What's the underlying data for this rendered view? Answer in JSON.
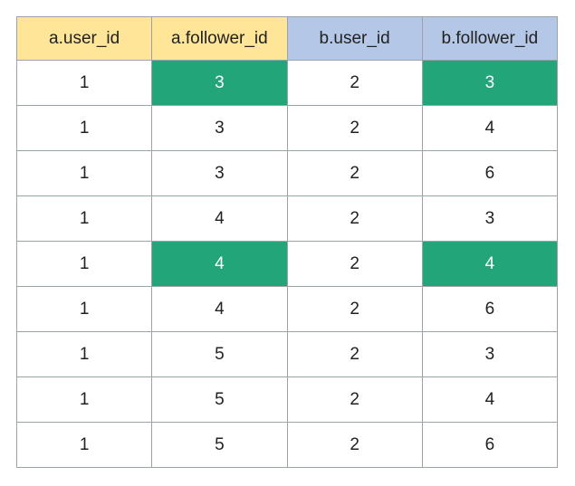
{
  "chart_data": {
    "type": "table",
    "title": "",
    "columns": [
      {
        "name": "a.user_id",
        "group": "a"
      },
      {
        "name": "a.follower_id",
        "group": "a"
      },
      {
        "name": "b.user_id",
        "group": "b"
      },
      {
        "name": "b.follower_id",
        "group": "b"
      }
    ],
    "rows": [
      {
        "a_user_id": 1,
        "a_follower_id": 3,
        "b_user_id": 2,
        "b_follower_id": 3,
        "highlight": [
          1,
          3
        ]
      },
      {
        "a_user_id": 1,
        "a_follower_id": 3,
        "b_user_id": 2,
        "b_follower_id": 4,
        "highlight": []
      },
      {
        "a_user_id": 1,
        "a_follower_id": 3,
        "b_user_id": 2,
        "b_follower_id": 6,
        "highlight": []
      },
      {
        "a_user_id": 1,
        "a_follower_id": 4,
        "b_user_id": 2,
        "b_follower_id": 3,
        "highlight": []
      },
      {
        "a_user_id": 1,
        "a_follower_id": 4,
        "b_user_id": 2,
        "b_follower_id": 4,
        "highlight": [
          1,
          3
        ]
      },
      {
        "a_user_id": 1,
        "a_follower_id": 4,
        "b_user_id": 2,
        "b_follower_id": 6,
        "highlight": []
      },
      {
        "a_user_id": 1,
        "a_follower_id": 5,
        "b_user_id": 2,
        "b_follower_id": 3,
        "highlight": []
      },
      {
        "a_user_id": 1,
        "a_follower_id": 5,
        "b_user_id": 2,
        "b_follower_id": 4,
        "highlight": []
      },
      {
        "a_user_id": 1,
        "a_follower_id": 5,
        "b_user_id": 2,
        "b_follower_id": 6,
        "highlight": []
      }
    ]
  },
  "colors": {
    "header_a": "#fee597",
    "header_b": "#b5c7e6",
    "highlight": "#22a579",
    "border": "#9aa4a7"
  }
}
